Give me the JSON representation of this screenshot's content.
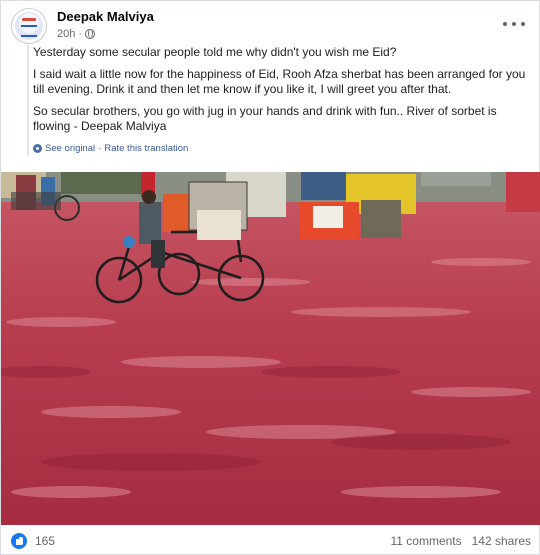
{
  "post": {
    "author": "Deepak Malviya",
    "time": "20h",
    "separator": "·",
    "paragraphs": [
      "Yesterday some secular people told me why didn't you wish me Eid?",
      "I said wait a little now for the happiness of Eid, Rooh Afza sherbat has been arranged for you till evening. Drink it and then let me know if you like it, I will greet you after that.",
      "So secular brothers, you go with jug in your hands and drink with fun.. River of sorbet is flowing - Deepak Malviya"
    ],
    "see_original": "See original",
    "translation_sep": "·",
    "rate_translation": "Rate this translation"
  },
  "footer": {
    "reaction_count": "165",
    "comments": "11 comments",
    "shares": "142 shares"
  },
  "icons": {
    "avatar": "profile-avatar",
    "privacy": "globe-icon",
    "menu": "more-options-icon",
    "translation": "gear-icon",
    "reaction": "like-icon"
  },
  "colors": {
    "link": "#385898",
    "meta": "#65676b",
    "reaction": "#1877f2",
    "water": "#b83a4b"
  }
}
